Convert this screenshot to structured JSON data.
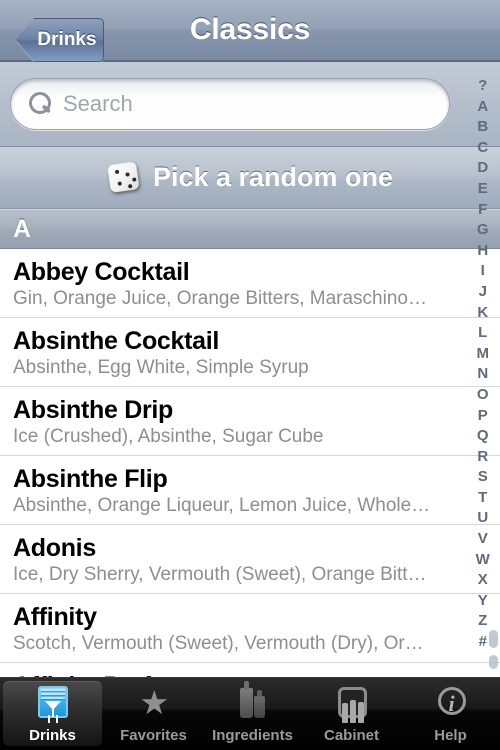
{
  "nav": {
    "back_label": "Drinks",
    "title": "Classics",
    "back_icon": "chevron-left-icon"
  },
  "search": {
    "placeholder": "Search",
    "value": "",
    "icon": "search-icon"
  },
  "random": {
    "label": "Pick a random one",
    "icon": "dice-icon"
  },
  "section": {
    "header": "A"
  },
  "list": [
    {
      "title": "Abbey Cocktail",
      "subtitle": "Gin, Orange Juice, Orange Bitters, Maraschino…"
    },
    {
      "title": "Absinthe Cocktail",
      "subtitle": "Absinthe, Egg White, Simple Syrup"
    },
    {
      "title": "Absinthe Drip",
      "subtitle": "Ice (Crushed), Absinthe, Sugar Cube"
    },
    {
      "title": "Absinthe Flip",
      "subtitle": "Absinthe, Orange Liqueur, Lemon Juice, Whole…"
    },
    {
      "title": "Adonis",
      "subtitle": "Ice, Dry Sherry, Vermouth (Sweet), Orange Bitters"
    },
    {
      "title": "Affinity",
      "subtitle": "Scotch, Vermouth (Sweet), Vermouth (Dry), Oran…"
    },
    {
      "title": "Affinity Perfect",
      "subtitle": ""
    }
  ],
  "index": [
    "?",
    "A",
    "B",
    "C",
    "D",
    "E",
    "F",
    "G",
    "H",
    "I",
    "J",
    "K",
    "L",
    "M",
    "N",
    "O",
    "P",
    "Q",
    "R",
    "S",
    "T",
    "U",
    "V",
    "W",
    "X",
    "Y",
    "Z",
    "#"
  ],
  "tabs": [
    {
      "label": "Drinks",
      "icon": "drinks-glass-icon",
      "selected": true
    },
    {
      "label": "Favorites",
      "icon": "star-icon",
      "selected": false
    },
    {
      "label": "Ingredients",
      "icon": "bottles-icon",
      "selected": false
    },
    {
      "label": "Cabinet",
      "icon": "cabinet-icon",
      "selected": false
    },
    {
      "label": "Help",
      "icon": "info-icon",
      "selected": false
    }
  ],
  "colors": {
    "nav_bar": "#8795ac",
    "accent_blue": "#2fa8e8",
    "tab_bar": "#000000",
    "index_text": "#5f6b7e",
    "subtitle_text": "#8e8e8e"
  }
}
